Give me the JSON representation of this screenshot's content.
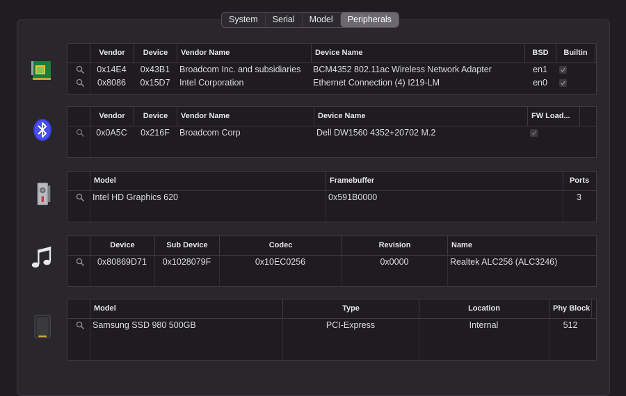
{
  "tabs": [
    {
      "label": "System"
    },
    {
      "label": "Serial"
    },
    {
      "label": "Model"
    },
    {
      "label": "Peripherals",
      "active": true
    }
  ],
  "network": {
    "headers": [
      "Vendor",
      "Device",
      "Vendor Name",
      "Device Name",
      "BSD",
      "Builtin"
    ],
    "rows": [
      {
        "vendor": "0x14E4",
        "device": "0x43B1",
        "vendor_name": "Broadcom Inc. and subsidiaries",
        "device_name": "BCM4352 802.11ac Wireless Network Adapter",
        "bsd": "en1",
        "builtin": true
      },
      {
        "vendor": "0x8086",
        "device": "0x15D7",
        "vendor_name": "Intel Corporation",
        "device_name": "Ethernet Connection (4) I219-LM",
        "bsd": "en0",
        "builtin": true
      }
    ]
  },
  "bluetooth": {
    "headers": [
      "Vendor",
      "Device",
      "Vendor Name",
      "Device Name",
      "FW Load..."
    ],
    "rows": [
      {
        "vendor": "0x0A5C",
        "device": "0x216F",
        "vendor_name": "Broadcom Corp",
        "device_name": "Dell DW1560 4352+20702 M.2",
        "fw_load": true
      }
    ]
  },
  "graphics": {
    "headers": [
      "Model",
      "Framebuffer",
      "Ports"
    ],
    "rows": [
      {
        "model": "Intel HD Graphics 620",
        "framebuffer": "0x591B0000",
        "ports": "3"
      }
    ]
  },
  "audio": {
    "headers": [
      "Device",
      "Sub Device",
      "Codec",
      "Revision",
      "Name"
    ],
    "rows": [
      {
        "device": "0x80869D71",
        "sub_device": "0x1028079F",
        "codec": "0x10EC0256",
        "revision": "0x0000",
        "name": "Realtek ALC256 (ALC3246)"
      }
    ]
  },
  "storage": {
    "headers": [
      "Model",
      "Type",
      "Location",
      "Phy Block"
    ],
    "rows": [
      {
        "model": "Samsung SSD 980 500GB",
        "type": "PCI-Express",
        "location": "Internal",
        "phy_block": "512"
      }
    ]
  }
}
